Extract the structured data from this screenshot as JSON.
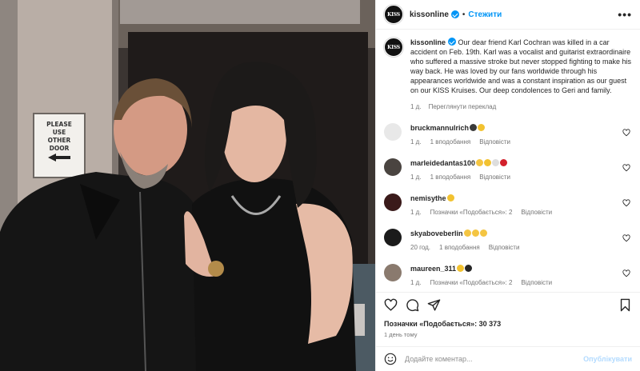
{
  "colors": {
    "accent": "#0095f6",
    "text": "#262626",
    "muted": "#737373",
    "post_disabled": "#b3dbff"
  },
  "photo": {
    "sign_lines": [
      "PLEASE",
      "USE",
      "OTHER",
      "DOOR"
    ]
  },
  "header": {
    "avatar_text": "KISS",
    "username": "kissonline",
    "separator": "•",
    "follow_label": "Стежити",
    "more_label": "•••"
  },
  "caption": {
    "username": "kissonline",
    "text": "Our dear friend Karl Cochran was killed in a car accident on Feb. 19th. Karl was a vocalist and guitarist extraordinaire who suffered a massive stroke but never stopped fighting to make his way back. He was loved by our fans worldwide through his appearances worldwide and was a constant inspiration as our guest on our KISS Kruises. Our deep condolences to Geri and family.",
    "age": "1 д.",
    "translate_label": "Переглянути переклад"
  },
  "comments": [
    {
      "username": "bruckmannulrich",
      "emoji": [
        "#3a3a3a",
        "#f2c230"
      ],
      "age": "1 д.",
      "likes": "",
      "replies": "1 вподобання",
      "reply_label": "Відповісти",
      "avatar_color": "#e8e8e8"
    },
    {
      "username": "marleidedantas100",
      "emoji": [
        "#f4c542",
        "#f2c230",
        "#dddddd",
        "#d2202b"
      ],
      "age": "1 д.",
      "likes": "",
      "replies": "1 вподобання",
      "reply_label": "Відповісти",
      "avatar_color": "#4a4440"
    },
    {
      "username": "nemisythe",
      "emoji": [
        "#f2c230"
      ],
      "age": "1 д.",
      "likes": "",
      "replies": "Позначки «Подобається»: 2",
      "reply_label": "Відповісти",
      "avatar_color": "#3a1a1a"
    },
    {
      "username": "skyaboveberlin",
      "emoji": [
        "#f4c542",
        "#f4c542",
        "#f4c542"
      ],
      "age": "20 год.",
      "likes": "",
      "replies": "1 вподобання",
      "reply_label": "Відповісти",
      "avatar_color": "#1b1b1b"
    },
    {
      "username": "maureen_311",
      "emoji": [
        "#f2c230",
        "#262626"
      ],
      "age": "1 д.",
      "likes": "",
      "replies": "Позначки «Подобається»: 2",
      "reply_label": "Відповісти",
      "avatar_color": "#8a7a6e"
    }
  ],
  "actions": {
    "likes_text": "Позначки «Подобається»: 30 373",
    "time_text": "1 день тому"
  },
  "add_comment": {
    "placeholder": "Додайте коментар...",
    "post_label": "Опублікувати"
  }
}
